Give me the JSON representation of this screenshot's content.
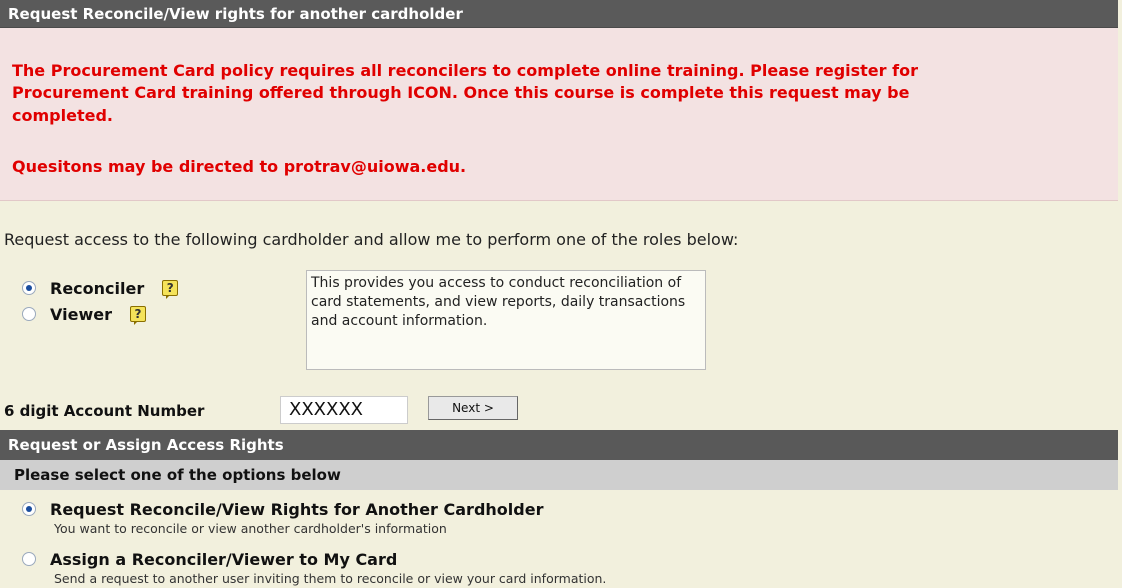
{
  "header": {
    "title": "Request Reconcile/View rights for another cardholder"
  },
  "alert": {
    "line1": "The Procurement Card policy requires all reconcilers to complete online training. Please register for",
    "line2": "Procurement Card training offered through ICON. Once this course is complete this request may be",
    "line3": "completed.",
    "line4": "Quesitons may be directed to protrav@uiowa.edu."
  },
  "intro": "Request access to the following cardholder and allow me to perform one of the roles below:",
  "roles": [
    {
      "label": "Reconciler",
      "selected": true,
      "help_icon": "help-icon"
    },
    {
      "label": "Viewer",
      "selected": false,
      "help_icon": "help-icon"
    }
  ],
  "role_description": "This provides you access to conduct reconciliation of card statements, and view reports, daily transactions and account information.",
  "account": {
    "label": "6 digit Account Number",
    "value": "XXXXXX",
    "next_label": "Next >"
  },
  "access_section": {
    "title": "Request or Assign Access Rights",
    "subtitle": "Please select one of the options below"
  },
  "options": [
    {
      "title": "Request Reconcile/View Rights for Another Cardholder",
      "description": "You want to reconcile or view another cardholder's information",
      "selected": true
    },
    {
      "title": "Assign a Reconciler/Viewer to My Card",
      "description": "Send a request to another user inviting them to reconcile or view your card information.",
      "selected": false
    }
  ],
  "colors": {
    "header_bg": "#5a5a5a",
    "alert_bg": "#f3e2e2",
    "alert_text": "#e00000",
    "page_bg": "#f2f0dd",
    "sub_bar_bg": "#cfcfcf"
  }
}
